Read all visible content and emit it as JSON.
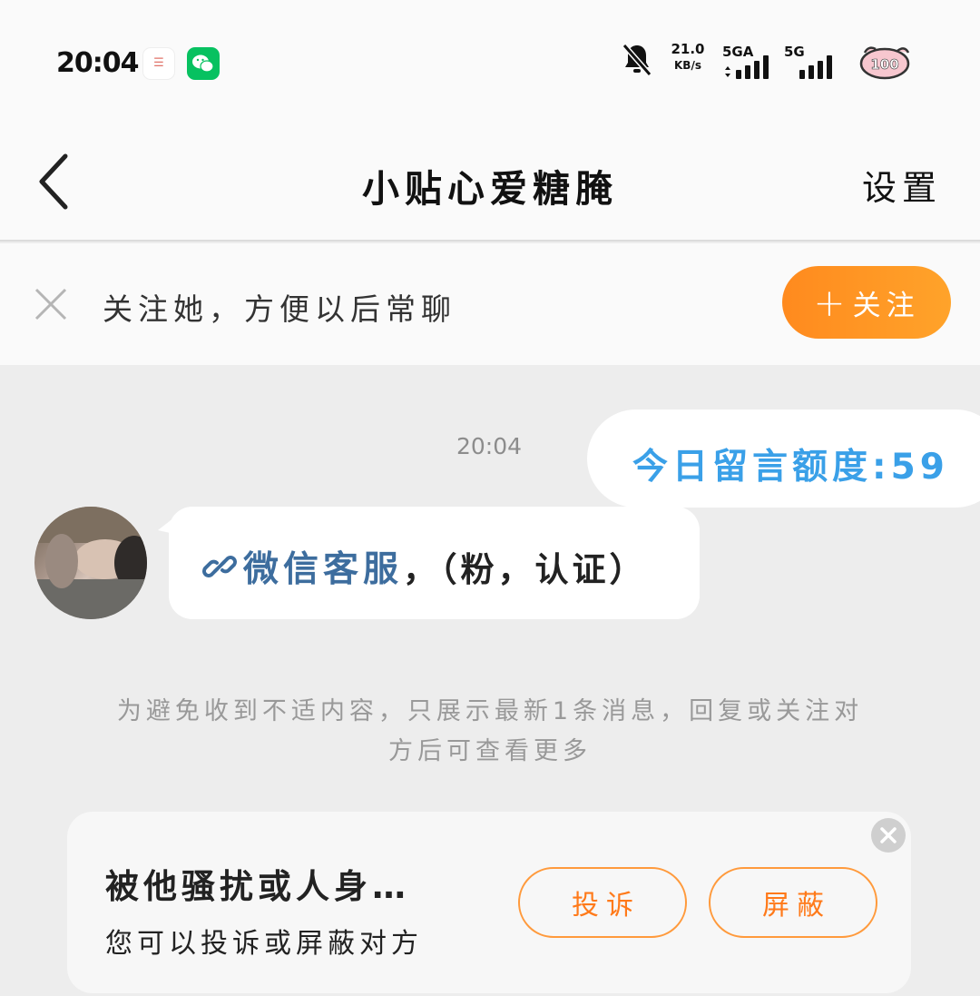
{
  "status_bar": {
    "time": "20:04",
    "small_icon_text": "☰",
    "net_speed_value": "21.0",
    "net_speed_unit": "KB/s",
    "signal1_label": "5GA",
    "signal2_label": "5G",
    "battery_level": "100"
  },
  "header": {
    "title": "小贴心爱糖腌",
    "settings_label": "设置"
  },
  "follow_banner": {
    "text": "关注她，方便以后常聊",
    "button_plus": "+",
    "button_label": "关注",
    "accent_color": "#ff8a1e"
  },
  "messages": {
    "time": "20:04",
    "outgoing_text": "今日留言额度:59",
    "incoming_link_text": "微信客服",
    "incoming_plain_text": "，（粉，认证）"
  },
  "notice": {
    "line1": "为避免收到不适内容，只展示最新1条消息，回复或关注对",
    "line2": "方后可查看更多"
  },
  "report_card": {
    "title": "被他骚扰或人身…",
    "subtitle": "您可以投诉或屏蔽对方",
    "complain_label": "投诉",
    "block_label": "屏蔽"
  }
}
